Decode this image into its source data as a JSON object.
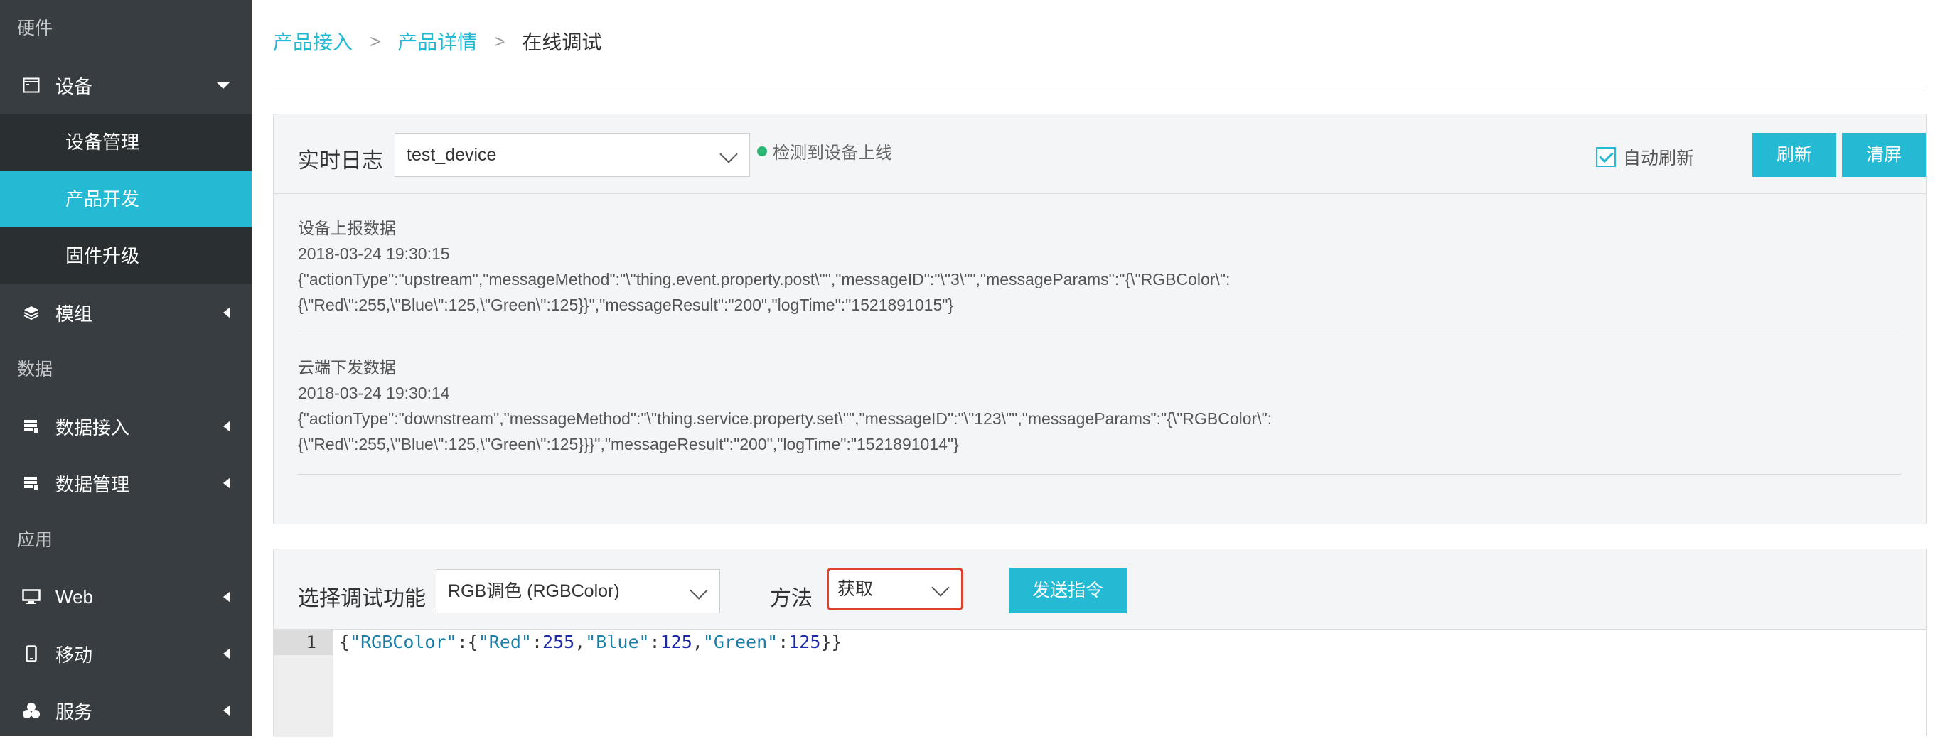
{
  "sidebar": {
    "sections": {
      "hardware": "硬件",
      "data": "数据",
      "app": "应用"
    },
    "items": {
      "device": "设备",
      "device_manage": "设备管理",
      "product_dev": "产品开发",
      "firmware": "固件升级",
      "module": "模组",
      "data_access": "数据接入",
      "data_manage": "数据管理",
      "web": "Web",
      "mobile": "移动",
      "service": "服务"
    }
  },
  "breadcrumb": {
    "item1": "产品接入",
    "item2": "产品详情",
    "current": "在线调试",
    "separator": ">"
  },
  "log_panel": {
    "title": "实时日志",
    "device": "test_device",
    "status": "检测到设备上线",
    "auto_refresh": "自动刷新",
    "auto_refresh_checked": true,
    "refresh": "刷新",
    "clear": "清屏",
    "entries": [
      {
        "type": "设备上报数据",
        "time": "2018-03-24 19:30:15",
        "line1": "{\"actionType\":\"upstream\",\"messageMethod\":\"\\\"thing.event.property.post\\\"\",\"messageID\":\"\\\"3\\\"\",\"messageParams\":\"{\\\"RGBColor\\\":",
        "line2": "{\\\"Red\\\":255,\\\"Blue\\\":125,\\\"Green\\\":125}}\",\"messageResult\":\"200\",\"logTime\":\"1521891015\"}"
      },
      {
        "type": "云端下发数据",
        "time": "2018-03-24 19:30:14",
        "line1": "{\"actionType\":\"downstream\",\"messageMethod\":\"\\\"thing.service.property.set\\\"\",\"messageID\":\"\\\"123\\\"\",\"messageParams\":\"{\\\"RGBColor\\\":",
        "line2": "{\\\"Red\\\":255,\\\"Blue\\\":125,\\\"Green\\\":125}}}\",\"messageResult\":\"200\",\"logTime\":\"1521891014\"}"
      }
    ]
  },
  "debug_panel": {
    "function_label": "选择调试功能",
    "function_value": "RGB调色 (RGBColor)",
    "method_label": "方法",
    "method_value": "获取",
    "send": "发送指令",
    "editor": {
      "line_number": "1",
      "code": {
        "brace_open": "{",
        "key": "\"RGBColor\"",
        "colon_brace": ":{",
        "red_key": "\"Red\"",
        "red_val": "255",
        "blue_key": "\"Blue\"",
        "blue_val": "125",
        "green_key": "\"Green\"",
        "green_val": "125",
        "close": "}}",
        "colon": ":",
        "comma": ","
      }
    }
  },
  "colors": {
    "accent": "#24bad3",
    "sidebar_bg": "#373d41",
    "sidebar_sub_bg": "#2a2f32",
    "highlight_border": "#e0412f",
    "status_online": "#2bb673"
  }
}
